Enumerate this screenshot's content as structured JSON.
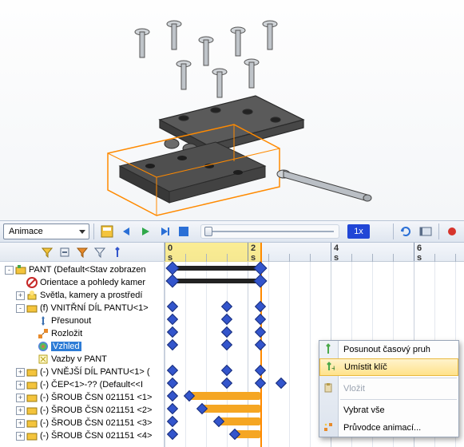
{
  "toolbar": {
    "mode_label": "Animace",
    "speed_label": "1x"
  },
  "ruler": {
    "marks": [
      "0 s",
      "2 s",
      "4 s",
      "6 s"
    ]
  },
  "tree": {
    "items": [
      {
        "indent": 0,
        "exp": "-",
        "icon": "asm",
        "label": "PANT  (Default<Stav zobrazen"
      },
      {
        "indent": 1,
        "exp": "",
        "icon": "no",
        "label": "Orientace a pohledy kamer"
      },
      {
        "indent": 1,
        "exp": "+",
        "icon": "light",
        "label": "Světla, kamery a prostředí"
      },
      {
        "indent": 1,
        "exp": "-",
        "icon": "part",
        "label": "(f) VNITŘNÍ DÍL PANTU<1>"
      },
      {
        "indent": 2,
        "exp": "",
        "icon": "move",
        "label": "Přesunout"
      },
      {
        "indent": 2,
        "exp": "",
        "icon": "explode",
        "label": "Rozložit"
      },
      {
        "indent": 2,
        "exp": "",
        "icon": "appear",
        "label": "Vzhled",
        "selected": true
      },
      {
        "indent": 2,
        "exp": "",
        "icon": "mate",
        "label": "Vazby v PANT"
      },
      {
        "indent": 1,
        "exp": "+",
        "icon": "part",
        "label": "(-) VNĚJŠÍ DÍL PANTU<1> ("
      },
      {
        "indent": 1,
        "exp": "+",
        "icon": "part",
        "label": "(-) ČEP<1>-?? (Default<<I"
      },
      {
        "indent": 1,
        "exp": "+",
        "icon": "part",
        "label": "(-) ŠROUB ČSN 021151 <1>"
      },
      {
        "indent": 1,
        "exp": "+",
        "icon": "part",
        "label": "(-) ŠROUB ČSN 021151 <2>"
      },
      {
        "indent": 1,
        "exp": "+",
        "icon": "part",
        "label": "(-) ŠROUB ČSN 021151 <3>"
      },
      {
        "indent": 1,
        "exp": "+",
        "icon": "part",
        "label": "(-) ŠROUB ČSN 021151 <4>"
      }
    ]
  },
  "context": {
    "items": [
      {
        "label": "Posunout časový pruh",
        "icon": "key-green"
      },
      {
        "label": "Umístit klíč",
        "icon": "key-plus",
        "highlight": true
      },
      {
        "label": "Vložit",
        "icon": "paste",
        "disabled": true
      },
      {
        "label": "Vybrat vše"
      },
      {
        "label": "Průvodce animací...",
        "icon": "wizard"
      }
    ]
  },
  "chart_data": {
    "type": "timeline",
    "time_unit": "s",
    "time_range": [
      0,
      7
    ],
    "playhead": 2.3,
    "tracks": [
      {
        "row": 0,
        "bars": [
          {
            "from": 0.2,
            "to": 2.3,
            "style": "black"
          }
        ],
        "keys": [
          0.2,
          2.3
        ]
      },
      {
        "row": 1,
        "bars": [
          {
            "from": 0.2,
            "to": 2.3,
            "style": "black"
          }
        ],
        "keys": [
          0.2,
          2.3
        ]
      },
      {
        "row": 3,
        "keys": [
          0.2,
          1.5,
          2.3
        ]
      },
      {
        "row": 4,
        "keys": [
          0.2,
          1.5,
          2.3
        ]
      },
      {
        "row": 5,
        "keys": [
          0.2,
          1.5,
          2.3
        ]
      },
      {
        "row": 6,
        "keys": [
          0.2,
          1.5,
          2.3
        ]
      },
      {
        "row": 8,
        "keys": [
          0.2,
          1.5,
          2.3
        ]
      },
      {
        "row": 9,
        "keys": [
          0.2,
          1.5,
          2.3
        ],
        "key_extra": [
          2.8
        ]
      },
      {
        "row": 10,
        "bars": [
          {
            "from": 0.6,
            "to": 2.3,
            "style": "orange"
          }
        ],
        "keys": [
          0.2,
          0.6
        ]
      },
      {
        "row": 11,
        "bars": [
          {
            "from": 0.9,
            "to": 2.3,
            "style": "orange"
          }
        ],
        "keys": [
          0.2,
          0.9
        ]
      },
      {
        "row": 12,
        "bars": [
          {
            "from": 1.3,
            "to": 2.3,
            "style": "orange"
          }
        ],
        "keys": [
          0.2,
          1.3
        ]
      },
      {
        "row": 13,
        "bars": [
          {
            "from": 1.7,
            "to": 2.3,
            "style": "orange"
          }
        ],
        "keys": [
          0.2,
          1.7
        ]
      }
    ]
  }
}
